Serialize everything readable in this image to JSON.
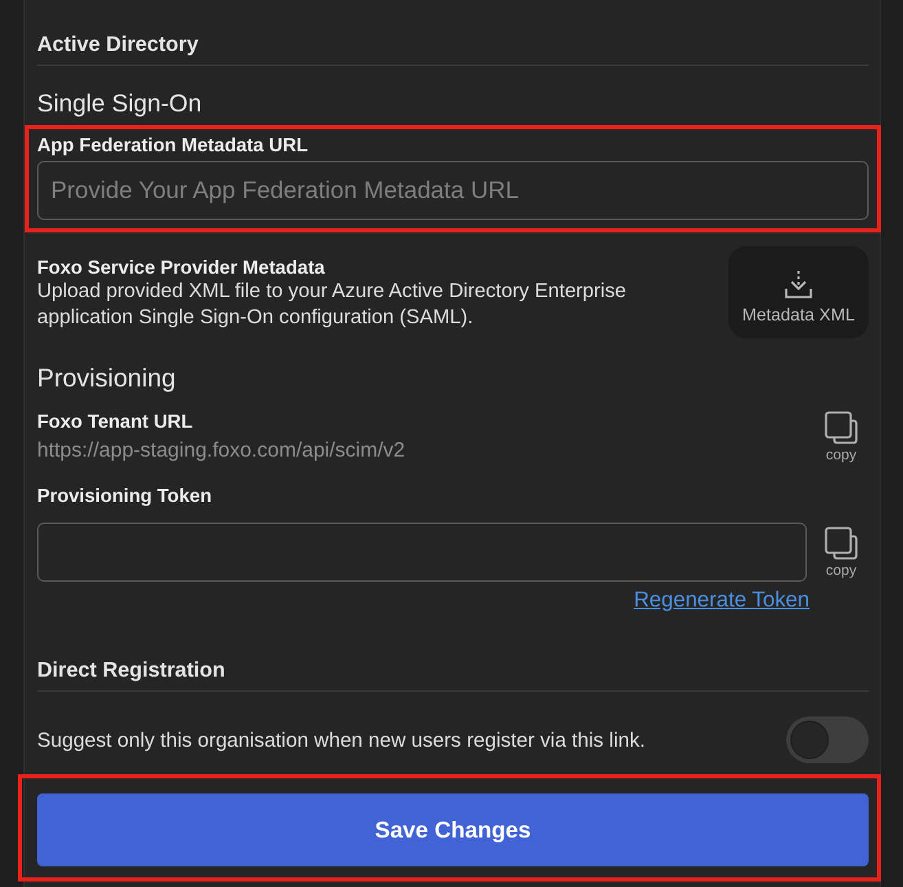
{
  "active_directory": {
    "title": "Active Directory"
  },
  "single_sign_on": {
    "title": "Single Sign-On",
    "metadata_url": {
      "label": "App Federation Metadata URL",
      "placeholder": "Provide Your App Federation Metadata URL",
      "highlighted": true
    },
    "service_provider": {
      "title": "Foxo Service Provider Metadata",
      "description": "Upload provided XML file to your Azure Active Directory Enterprise application Single Sign-On configuration (SAML).",
      "download_button": "Metadata XML"
    }
  },
  "provisioning": {
    "title": "Provisioning",
    "tenant_url": {
      "label": "Foxo Tenant URL",
      "value": "https://app-staging.foxo.com/api/scim/v2",
      "copy_label": "copy"
    },
    "token": {
      "label": "Provisioning Token",
      "copy_label": "copy",
      "regenerate_link": "Regenerate Token"
    }
  },
  "direct_registration": {
    "title": "Direct Registration",
    "suggest_only": {
      "label": "Suggest only this organisation when new users register via this link.",
      "on": false
    }
  },
  "save_button": {
    "label": "Save Changes",
    "highlighted": true
  }
}
